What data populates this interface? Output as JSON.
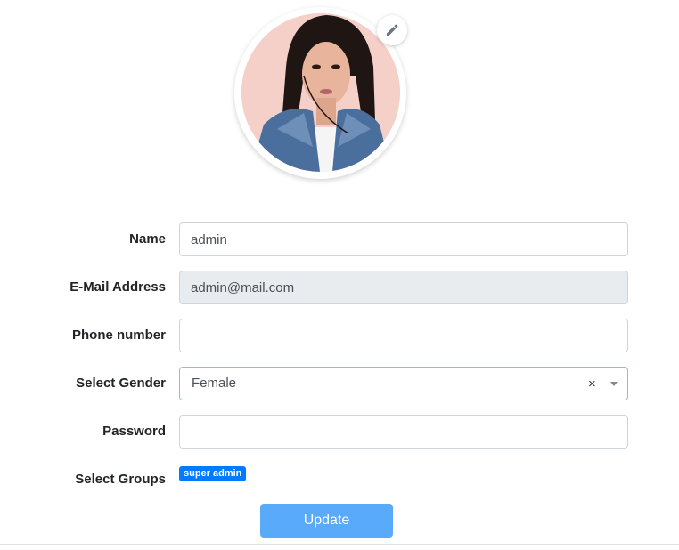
{
  "profile": {
    "edit_icon": "pencil-icon"
  },
  "form": {
    "name": {
      "label": "Name",
      "value": "admin"
    },
    "email": {
      "label": "E-Mail Address",
      "value": "admin@mail.com"
    },
    "phone": {
      "label": "Phone number",
      "value": ""
    },
    "gender": {
      "label": "Select Gender",
      "value": "Female",
      "clear": "×"
    },
    "password": {
      "label": "Password",
      "value": ""
    },
    "groups": {
      "label": "Select Groups",
      "selected": [
        "super admin"
      ]
    }
  },
  "actions": {
    "update_label": "Update"
  },
  "colors": {
    "primary": "#007bff",
    "button": "#5aaafb",
    "focus_border": "#80bdff",
    "disabled_bg": "#e9ecef"
  }
}
